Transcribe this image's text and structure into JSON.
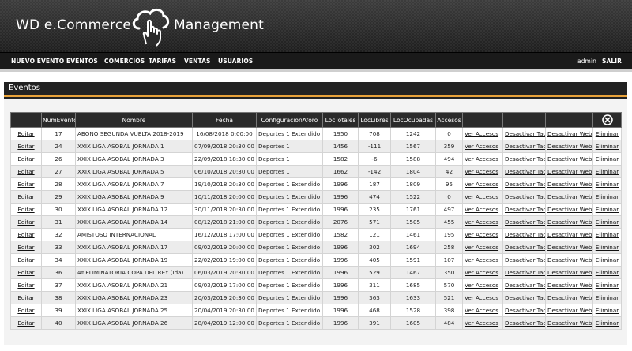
{
  "header": {
    "title_left": "WD e.Commerce",
    "title_right": "Management",
    "logo_icon": "cloud-hand-icon"
  },
  "nav": {
    "items": [
      {
        "label": "NUEVO EVENTO"
      },
      {
        "label": "EVENTOS"
      },
      {
        "label": "COMERCIOS"
      },
      {
        "label": "TARIFAS"
      },
      {
        "label": "VENTAS"
      },
      {
        "label": "USUARIOS"
      }
    ],
    "user": "admin",
    "logout": "SALIR"
  },
  "section": {
    "title": "Eventos"
  },
  "table": {
    "columns": [
      "",
      "NumEvento",
      "Nombre",
      "Fecha",
      "ConfiguracionAforo",
      "LocTotales",
      "LocLibres",
      "LocOcupadas",
      "Accesos",
      "",
      "",
      "",
      ""
    ],
    "close_icon": "close-circle-icon",
    "action_labels": {
      "edit": "Editar",
      "view": "Ver Accesos",
      "deactivate_taq": "Desactivar Taq",
      "deactivate_web": "Desactivar Web",
      "delete": "Eliminar"
    },
    "rows": [
      {
        "num": "17",
        "name": "ABONO SEGUNDA VUELTA 2018-2019",
        "date": "16/08/2018 0:00:00",
        "config": "Deportes 1 Extendido",
        "total": "1950",
        "free": "708",
        "occupied": "1242",
        "access": "0"
      },
      {
        "num": "24",
        "name": "XXIX LIGA ASOBAL JORNADA 1",
        "date": "07/09/2018 20:30:00",
        "config": "Deportes 1",
        "total": "1456",
        "free": "-111",
        "occupied": "1567",
        "access": "359"
      },
      {
        "num": "26",
        "name": "XXIX LIGA ASOBAL JORNADA 3",
        "date": "22/09/2018 18:30:00",
        "config": "Deportes 1",
        "total": "1582",
        "free": "-6",
        "occupied": "1588",
        "access": "494"
      },
      {
        "num": "27",
        "name": "XXIX LIGA ASOBAL JORNADA 5",
        "date": "06/10/2018 20:30:00",
        "config": "Deportes 1",
        "total": "1662",
        "free": "-142",
        "occupied": "1804",
        "access": "42"
      },
      {
        "num": "28",
        "name": "XXIX LIGA ASOBAL JORNADA 7",
        "date": "19/10/2018 20:30:00",
        "config": "Deportes 1 Extendido",
        "total": "1996",
        "free": "187",
        "occupied": "1809",
        "access": "95"
      },
      {
        "num": "29",
        "name": "XXIX LIGA ASOBAL JORNADA 9",
        "date": "10/11/2018 20:00:00",
        "config": "Deportes 1 Extendido",
        "total": "1996",
        "free": "474",
        "occupied": "1522",
        "access": "0"
      },
      {
        "num": "30",
        "name": "XXIX LIGA ASOBAL JORNADA 12",
        "date": "30/11/2018 20:30:00",
        "config": "Deportes 1 Extendido",
        "total": "1996",
        "free": "235",
        "occupied": "1761",
        "access": "497"
      },
      {
        "num": "31",
        "name": "XXIX LIGA ASOBAL JORNADA 14",
        "date": "08/12/2018 21:00:00",
        "config": "Deportes 1 Extendido",
        "total": "2076",
        "free": "571",
        "occupied": "1505",
        "access": "455"
      },
      {
        "num": "32",
        "name": "AMISTOSO INTERNACIONAL",
        "date": "16/12/2018 17:00:00",
        "config": "Deportes 1 Extendido",
        "total": "1582",
        "free": "121",
        "occupied": "1461",
        "access": "195"
      },
      {
        "num": "33",
        "name": "XXIX LIGA ASOBAL JORNADA 17",
        "date": "09/02/2019 20:00:00",
        "config": "Deportes 1 Extendido",
        "total": "1996",
        "free": "302",
        "occupied": "1694",
        "access": "258"
      },
      {
        "num": "34",
        "name": "XXIX LIGA ASOBAL JORNADA 19",
        "date": "22/02/2019 19:00:00",
        "config": "Deportes 1 Extendido",
        "total": "1996",
        "free": "405",
        "occupied": "1591",
        "access": "107"
      },
      {
        "num": "36",
        "name": "4ª ELIMINATORIA COPA DEL REY (Ida)",
        "date": "06/03/2019 20:30:00",
        "config": "Deportes 1 Extendido",
        "total": "1996",
        "free": "529",
        "occupied": "1467",
        "access": "350"
      },
      {
        "num": "37",
        "name": "XXIX LIGA ASOBAL JORNADA 21",
        "date": "09/03/2019 17:00:00",
        "config": "Deportes 1 Extendido",
        "total": "1996",
        "free": "311",
        "occupied": "1685",
        "access": "570"
      },
      {
        "num": "38",
        "name": "XXIX LIGA ASOBAL JORNADA 23",
        "date": "20/03/2019 20:30:00",
        "config": "Deportes 1 Extendido",
        "total": "1996",
        "free": "363",
        "occupied": "1633",
        "access": "521"
      },
      {
        "num": "39",
        "name": "XXIX LIGA ASOBAL JORNADA 25",
        "date": "20/04/2019 20:30:00",
        "config": "Deportes 1 Extendido",
        "total": "1996",
        "free": "468",
        "occupied": "1528",
        "access": "398"
      },
      {
        "num": "40",
        "name": "XXIX LIGA ASOBAL JORNADA 26",
        "date": "28/04/2019 12:00:00",
        "config": "Deportes 1 Extendido",
        "total": "1996",
        "free": "391",
        "occupied": "1605",
        "access": "484"
      }
    ]
  },
  "colors": {
    "header_bg": "#2b2b2b",
    "nav_bg": "#1a1a1a",
    "accent": "#e8a23a",
    "table_header_bg": "#2a2a2a"
  }
}
